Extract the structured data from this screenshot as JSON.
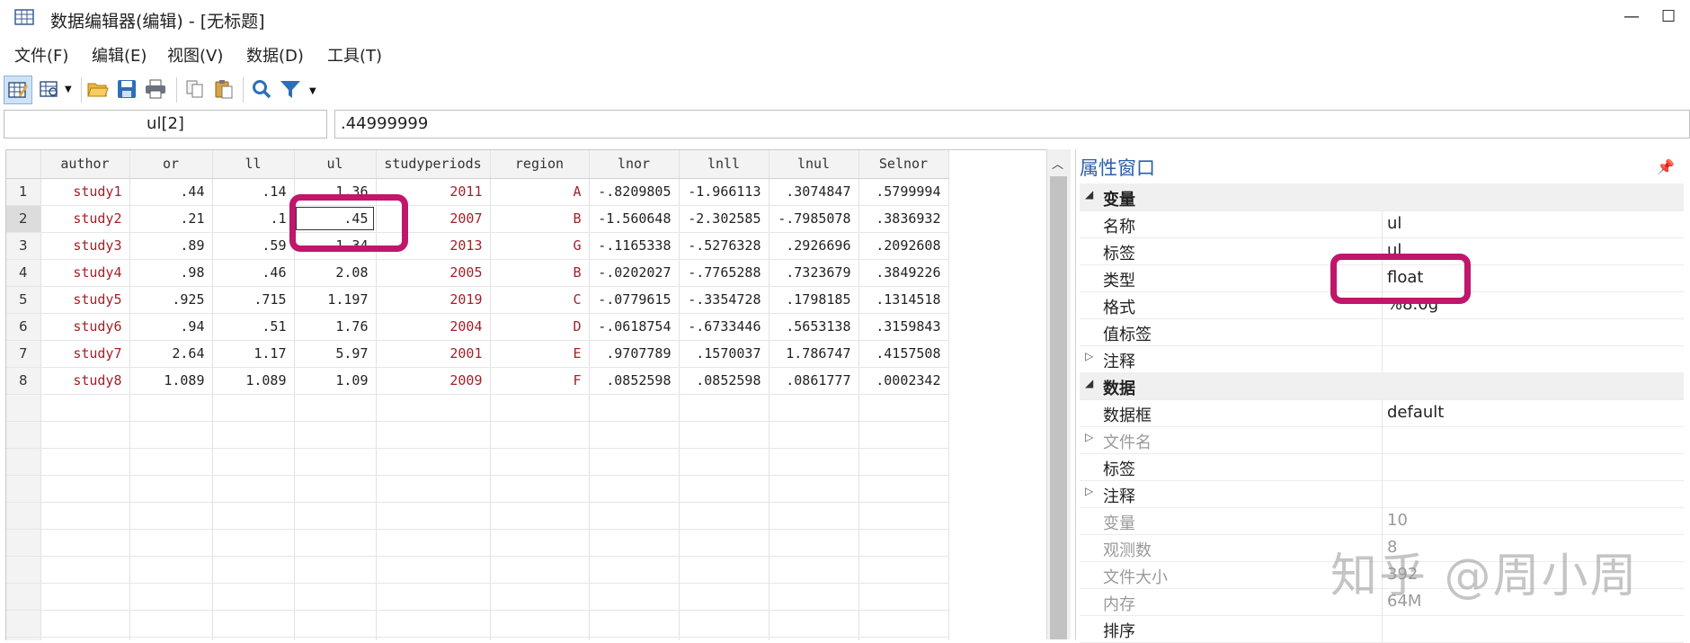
{
  "window": {
    "title": "数据编辑器(编辑) - [无标题]",
    "minimize_glyph": "—",
    "maximize_glyph": "☐"
  },
  "menu": [
    "文件(F)",
    "编辑(E)",
    "视图(V)",
    "数据(D)",
    "工具(T)"
  ],
  "toolbar": {
    "icons": [
      "edit-mode-icon",
      "browse-mode-icon",
      "open-folder-icon",
      "save-icon",
      "print-icon",
      "copy-icon",
      "paste-icon",
      "search-icon",
      "filter-icon"
    ]
  },
  "cell_ref": "ul[2]",
  "cell_value": ".44999999",
  "grid": {
    "columns": [
      "author",
      "or",
      "ll",
      "ul",
      "studyperiods",
      "region",
      "lnor",
      "lnll",
      "lnul",
      "Selnor"
    ],
    "rows": [
      {
        "n": "1",
        "cells": [
          "study1",
          ".44",
          ".14",
          "1.36",
          "2011",
          "A",
          "-.8209805",
          "-1.966113",
          ".3074847",
          ".5799994"
        ]
      },
      {
        "n": "2",
        "cells": [
          "study2",
          ".21",
          ".1",
          ".45",
          "2007",
          "B",
          "-1.560648",
          "-2.302585",
          "-.7985078",
          ".3836932"
        ]
      },
      {
        "n": "3",
        "cells": [
          "study3",
          ".89",
          ".59",
          "1.34",
          "2013",
          "G",
          "-.1165338",
          "-.5276328",
          ".2926696",
          ".2092608"
        ]
      },
      {
        "n": "4",
        "cells": [
          "study4",
          ".98",
          ".46",
          "2.08",
          "2005",
          "B",
          "-.0202027",
          "-.7765288",
          ".7323679",
          ".3849226"
        ]
      },
      {
        "n": "5",
        "cells": [
          "study5",
          ".925",
          ".715",
          "1.197",
          "2019",
          "C",
          "-.0779615",
          "-.3354728",
          ".1798185",
          ".1314518"
        ]
      },
      {
        "n": "6",
        "cells": [
          "study6",
          ".94",
          ".51",
          "1.76",
          "2004",
          "D",
          "-.0618754",
          "-.6733446",
          ".5653138",
          ".3159843"
        ]
      },
      {
        "n": "7",
        "cells": [
          "study7",
          "2.64",
          "1.17",
          "5.97",
          "2001",
          "E",
          ".9707789",
          ".1570037",
          "1.786747",
          ".4157508"
        ]
      },
      {
        "n": "8",
        "cells": [
          "study8",
          "1.089",
          "1.089",
          "1.09",
          "2009",
          "F",
          ".0852598",
          ".0852598",
          ".0861777",
          ".0002342"
        ]
      }
    ]
  },
  "properties": {
    "title": "属性窗口",
    "rows": [
      {
        "label": "变量",
        "value": "",
        "section": true
      },
      {
        "label": "名称",
        "value": "ul"
      },
      {
        "label": "标签",
        "value": "ul"
      },
      {
        "label": "类型",
        "value": "float"
      },
      {
        "label": "格式",
        "value": "%8.0g"
      },
      {
        "label": "值标签",
        "value": ""
      },
      {
        "label": "注释",
        "value": "",
        "expandable": true
      },
      {
        "label": "数据",
        "value": "",
        "section": true
      },
      {
        "label": "数据框",
        "value": "default"
      },
      {
        "label": "文件名",
        "value": "",
        "expandable": true,
        "dim": true
      },
      {
        "label": "标签",
        "value": ""
      },
      {
        "label": "注释",
        "value": "",
        "expandable": true
      },
      {
        "label": "变量",
        "value": "10",
        "dim": true
      },
      {
        "label": "观测数",
        "value": "8",
        "dim": true
      },
      {
        "label": "文件大小",
        "value": "392",
        "dim": true
      },
      {
        "label": "内存",
        "value": "64M",
        "dim": true
      },
      {
        "label": "排序",
        "value": ""
      }
    ]
  },
  "watermark": "知乎 @周小周",
  "colors": {
    "highlight": "#c0166b",
    "string_text": "#a0222a",
    "panel_title": "#2a5fa8"
  }
}
